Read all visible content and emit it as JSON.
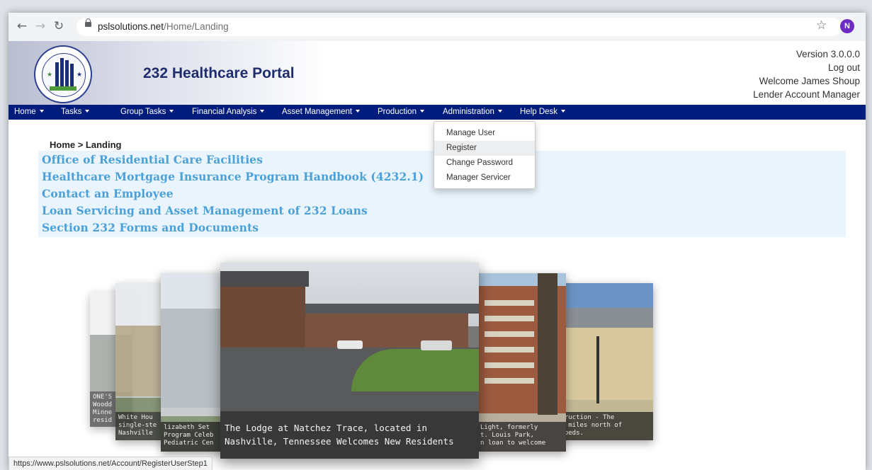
{
  "browser": {
    "url_host": "pslsolutions.net",
    "url_path": "/Home/Landing",
    "profile_initial": "N",
    "status_url": "https://www.pslsolutions.net/Account/RegisterUserStep1"
  },
  "header": {
    "title": "232 Healthcare Portal",
    "version": "Version 3.0.0.0",
    "logout": "Log out",
    "welcome": "Welcome James Shoup",
    "role": "Lender Account Manager"
  },
  "nav": {
    "items": [
      {
        "label": "Home"
      },
      {
        "label": "Tasks"
      },
      {
        "label": "Group Tasks"
      },
      {
        "label": "Financial Analysis"
      },
      {
        "label": "Asset Management"
      },
      {
        "label": "Production"
      },
      {
        "label": "Administration"
      },
      {
        "label": "Help Desk"
      }
    ]
  },
  "admin_menu": {
    "items": [
      {
        "label": "Manage User"
      },
      {
        "label": "Register"
      },
      {
        "label": "Change Password"
      },
      {
        "label": "Manager Servicer"
      }
    ],
    "highlighted_index": 1
  },
  "breadcrumb": "Home > Landing",
  "links": [
    "Office of Residential Care Facilities",
    "Healthcare Mortgage Insurance Program Handbook (4232.1)",
    "Contact an Employee",
    "Loan Servicing and Asset Management of 232 Loans",
    "Section 232 Forms and Documents"
  ],
  "carousel": {
    "main_caption_line1": "The Lodge at Natchez Trace, located in",
    "main_caption_line2": "Nashville, Tennessee Welcomes New Residents",
    "left1_caption": [
      "ONE'S",
      "Woodd",
      "Minne",
      "resid"
    ],
    "left2_caption": [
      "White Hou",
      "single-ste",
      "Nashville"
    ],
    "left3_caption": [
      "lizabeth Set",
      "Program Celeb",
      "Pediatric Cen"
    ],
    "right1_caption": [
      "Light, formerly",
      "t. Louis Park,",
      "n loan to welcome"
    ],
    "right2_caption": [
      "struction - The",
      "22 miles north of",
      "g beds."
    ]
  },
  "colors": {
    "navbar": "#001c7d",
    "link": "#4aa0d9",
    "link_panel": "#eaf4fc",
    "title": "#1f2d6f"
  }
}
